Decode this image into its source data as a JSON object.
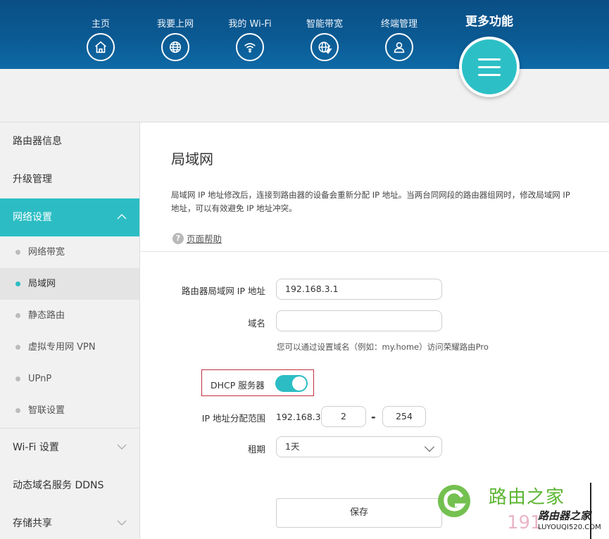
{
  "header": {
    "nav": [
      {
        "label": "主页",
        "icon": "home-icon"
      },
      {
        "label": "我要上网",
        "icon": "globe-icon"
      },
      {
        "label": "我的 Wi-Fi",
        "icon": "wifi-icon"
      },
      {
        "label": "智能带宽",
        "icon": "bandwidth-icon"
      },
      {
        "label": "终端管理",
        "icon": "user-icon"
      }
    ],
    "more_label": "更多功能",
    "more_icon": "menu-icon"
  },
  "sidebar": {
    "items": [
      {
        "label": "路由器信息"
      },
      {
        "label": "升级管理"
      },
      {
        "label": "网络设置",
        "active": true
      },
      {
        "label": "Wi-Fi 设置"
      },
      {
        "label": "动态域名服务 DDNS"
      },
      {
        "label": "存储共享"
      }
    ],
    "subitems": [
      {
        "label": "网络带宽"
      },
      {
        "label": "局域网",
        "active": true
      },
      {
        "label": "静态路由"
      },
      {
        "label": "虚拟专用网 VPN"
      },
      {
        "label": "UPnP"
      },
      {
        "label": "智联设置"
      }
    ]
  },
  "main": {
    "title": "局域网",
    "description": "局域网 IP 地址修改后，连接到路由器的设备会重新分配 IP 地址。当两台同网段的路由器组网时，修改局域网 IP 地址，可以有效避免 IP 地址冲突。",
    "help_label": "页面帮助",
    "form": {
      "ip_label": "路由器局域网 IP 地址",
      "ip_value": "192.168.3.1",
      "domain_label": "域名",
      "domain_value": "",
      "domain_hint": "您可以通过设置域名（例如：my.home）访问荣耀路由Pro",
      "dhcp_label": "DHCP 服务器",
      "dhcp_enabled": true,
      "range_label": "IP 地址分配范围",
      "range_prefix": "192.168.3.",
      "range_start": "2",
      "range_dash": "-",
      "range_end": "254",
      "lease_label": "租期",
      "lease_value": "1天",
      "save_label": "保存"
    }
  },
  "watermark": {
    "site_name": "路由之家",
    "stamp": "路由器之家",
    "stamp_url": "LUYOUQI520.COM",
    "number": "191"
  },
  "colors": {
    "header": "#0b5a93",
    "accent": "#2cbdc4",
    "highlight_border": "#c0303a"
  }
}
